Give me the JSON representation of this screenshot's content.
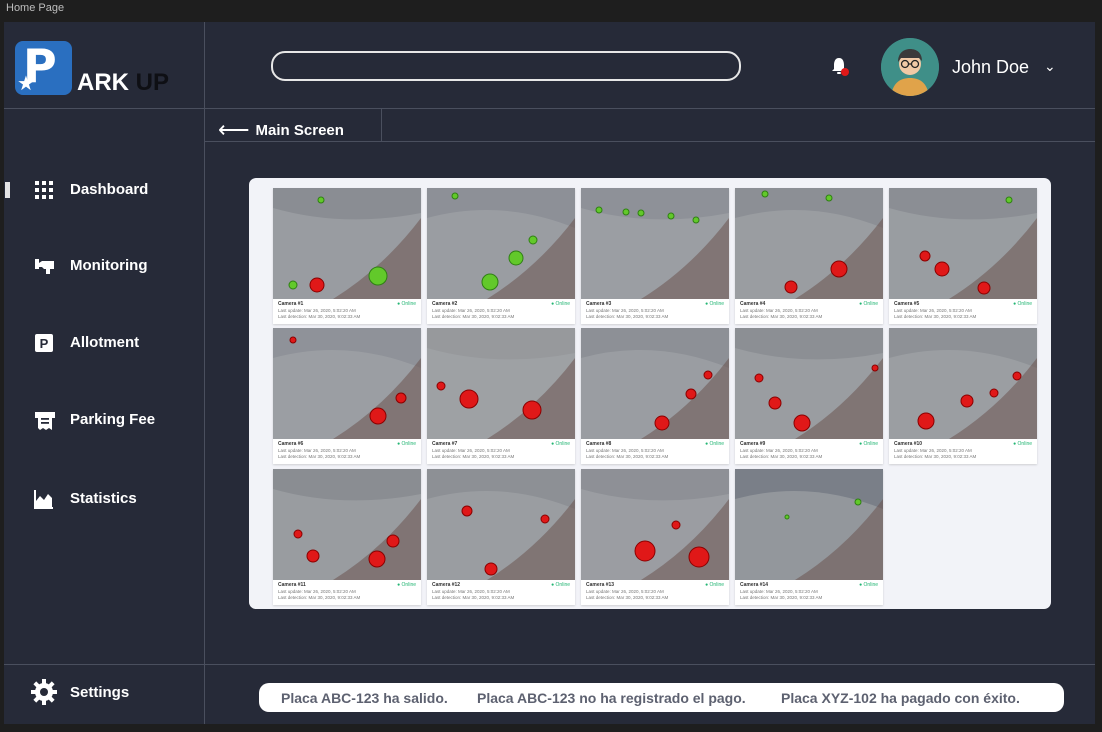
{
  "frame_title": "Home Page",
  "brand": {
    "logo_letter": "P",
    "name_part1": "ARK",
    "name_part2": "UP"
  },
  "search": {
    "placeholder": ""
  },
  "user": {
    "name": "John Doe"
  },
  "breadcrumb": {
    "label": "Main Screen"
  },
  "sidebar": {
    "items": [
      {
        "label": "Dashboard",
        "icon": "grid-icon"
      },
      {
        "label": "Monitoring",
        "icon": "security-camera-icon"
      },
      {
        "label": "Allotment",
        "icon": "parking-icon"
      },
      {
        "label": "Parking Fee",
        "icon": "ticket-icon"
      },
      {
        "label": "Statistics",
        "icon": "chart-icon"
      }
    ],
    "settings_label": "Settings"
  },
  "cameras": [
    {
      "name": "Camera #1",
      "status": "Online",
      "last_update": "Last update: Mar 26, 2020, 5:02:20 AM",
      "last_detection": "Last detection: Mar 30, 2020, 9:02:33 AM"
    },
    {
      "name": "Camera #2",
      "status": "Online",
      "last_update": "Last update: Mar 26, 2020, 5:02:20 AM",
      "last_detection": "Last detection: Mar 30, 2020, 9:02:33 AM"
    },
    {
      "name": "Camera #3",
      "status": "Online",
      "last_update": "Last update: Mar 26, 2020, 5:02:20 AM",
      "last_detection": "Last detection: Mar 30, 2020, 9:02:33 AM"
    },
    {
      "name": "Camera #4",
      "status": "Online",
      "last_update": "Last update: Mar 26, 2020, 5:02:20 AM",
      "last_detection": "Last detection: Mar 30, 2020, 9:02:33 AM"
    },
    {
      "name": "Camera #5",
      "status": "Online",
      "last_update": "Last update: Mar 26, 2020, 5:02:20 AM",
      "last_detection": "Last detection: Mar 30, 2020, 9:02:33 AM"
    },
    {
      "name": "Camera #6",
      "status": "Online",
      "last_update": "Last update: Mar 26, 2020, 5:02:20 AM",
      "last_detection": "Last detection: Mar 30, 2020, 9:02:33 AM"
    },
    {
      "name": "Camera #7",
      "status": "Online",
      "last_update": "Last update: Mar 26, 2020, 5:02:20 AM",
      "last_detection": "Last detection: Mar 30, 2020, 9:02:33 AM"
    },
    {
      "name": "Camera #8",
      "status": "Online",
      "last_update": "Last update: Mar 26, 2020, 5:02:20 AM",
      "last_detection": "Last detection: Mar 30, 2020, 9:02:33 AM"
    },
    {
      "name": "Camera #9",
      "status": "Online",
      "last_update": "Last update: Mar 26, 2020, 5:02:20 AM",
      "last_detection": "Last detection: Mar 30, 2020, 9:02:33 AM"
    },
    {
      "name": "Camera #10",
      "status": "Online",
      "last_update": "Last update: Mar 26, 2020, 5:02:20 AM",
      "last_detection": "Last detection: Mar 30, 2020, 9:02:33 AM"
    },
    {
      "name": "Camera #11",
      "status": "Online",
      "last_update": "Last update: Mar 26, 2020, 5:02:20 AM",
      "last_detection": "Last detection: Mar 30, 2020, 9:02:33 AM"
    },
    {
      "name": "Camera #12",
      "status": "Online",
      "last_update": "Last update: Mar 26, 2020, 5:02:20 AM",
      "last_detection": "Last detection: Mar 30, 2020, 9:02:33 AM"
    },
    {
      "name": "Camera #13",
      "status": "Online",
      "last_update": "Last update: Mar 26, 2020, 5:02:20 AM",
      "last_detection": "Last detection: Mar 30, 2020, 9:02:33 AM"
    },
    {
      "name": "Camera #14",
      "status": "Online",
      "last_update": "Last update: Mar 26, 2020, 5:02:20 AM",
      "last_detection": "Last detection: Mar 30, 2020, 9:02:33 AM"
    }
  ],
  "ticker": {
    "messages": [
      "Placa ABC-123 ha salido.",
      "Placa ABC-123 no ha registrado el pago.",
      "Placa XYZ-102 ha pagado con éxito."
    ]
  },
  "colors": {
    "background": "#262a38",
    "accent": "#2a6fc0",
    "spot_free": "#62c92a",
    "spot_occupied": "#e01818",
    "status_online": "#22b573"
  }
}
